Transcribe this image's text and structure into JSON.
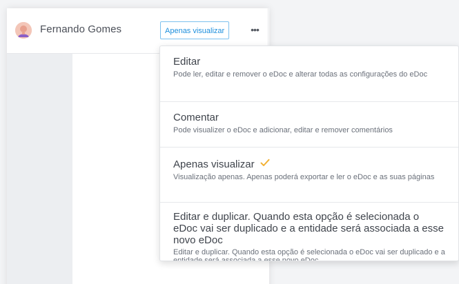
{
  "person": {
    "name": "Fernando Gomes",
    "permission_label": "Apenas visualizar",
    "more_label": "•••"
  },
  "menu": {
    "items": [
      {
        "title": "Editar",
        "description": "Pode ler, editar e remover o eDoc e alterar todas as configurações do eDoc",
        "selected": false
      },
      {
        "title": "Comentar",
        "description": "Pode visualizer o eDoc e adicionar, editar e remover comentários",
        "selected": false
      },
      {
        "title": "Apenas visualizar",
        "description": "Visualização apenas. Apenas poderá exportar e ler o eDoc e as suas páginas",
        "selected": true
      },
      {
        "title": "Editar e duplicar. Quando esta opção é selecionada o eDoc vai ser duplicado e a entidade será associada a esse novo eDoc",
        "description": "Editar e duplicar. Quando esta opção é selecionada o eDoc vai ser duplicado e a entidade será associada a esse novo eDoc",
        "selected": false
      }
    ]
  },
  "colors": {
    "accent": "#1d8fdd",
    "check": "#f2b134"
  },
  "icons": {
    "avatar": "user-avatar-icon",
    "more": "more-horizontal-icon",
    "check": "check-icon"
  }
}
